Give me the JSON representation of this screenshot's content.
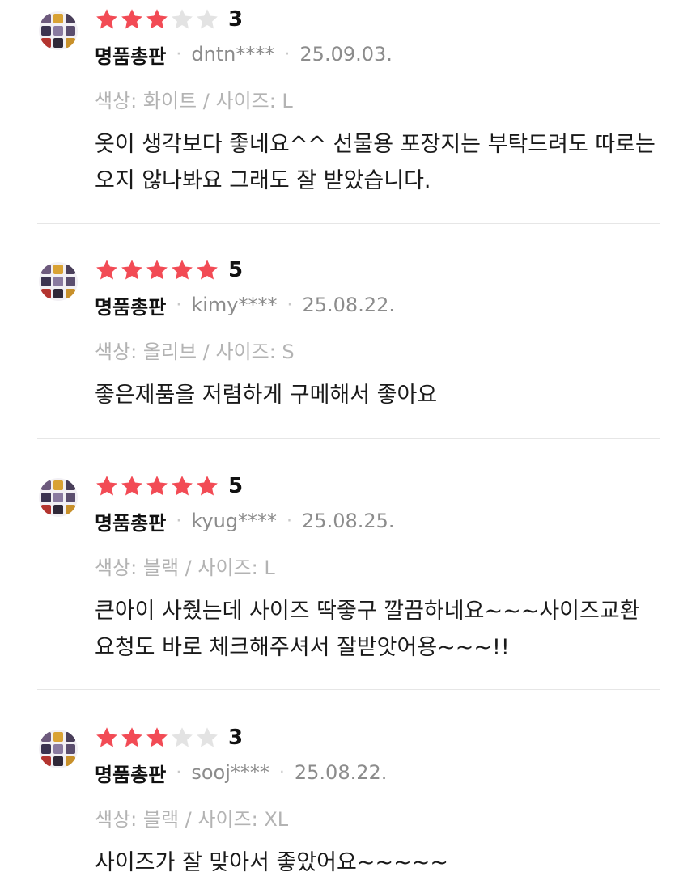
{
  "colors": {
    "star_filled": "#f24b55",
    "star_empty": "#e3e3e3",
    "text": "#1a1a1a",
    "meta": "#8c8c8c",
    "option": "#b3b3b3",
    "divider": "#e6e6e6"
  },
  "reviews": [
    {
      "rating": 3,
      "score_label": "3",
      "seller": "명품총판",
      "separator": "·",
      "user": "dntn****",
      "date": "25.09.03.",
      "option": "색상: 화이트 / 사이즈: L",
      "text": "옷이 생각보다 좋네요^^ 선물용 포장지는 부탁드려도 따로는 오지 않나봐요 그래도 잘 받았습니다."
    },
    {
      "rating": 5,
      "score_label": "5",
      "seller": "명품총판",
      "separator": "·",
      "user": "kimy****",
      "date": "25.08.22.",
      "option": "색상: 올리브 / 사이즈: S",
      "text": "좋은제품을 저렴하게 구메해서 좋아요"
    },
    {
      "rating": 5,
      "score_label": "5",
      "seller": "명품총판",
      "separator": "·",
      "user": "kyug****",
      "date": "25.08.25.",
      "option": "색상: 블랙 / 사이즈: L",
      "text": "큰아이 사줬는데 사이즈 딱좋구 깔끔하네요~~~사이즈교환 요청도 바로 체크해주셔서 잘받앗어용~~~!!"
    },
    {
      "rating": 3,
      "score_label": "3",
      "seller": "명품총판",
      "separator": "·",
      "user": "sooj****",
      "date": "25.08.22.",
      "option": "색상: 블랙 / 사이즈: XL",
      "text": "사이즈가 잘 맞아서 좋았어요~~~~~"
    }
  ]
}
